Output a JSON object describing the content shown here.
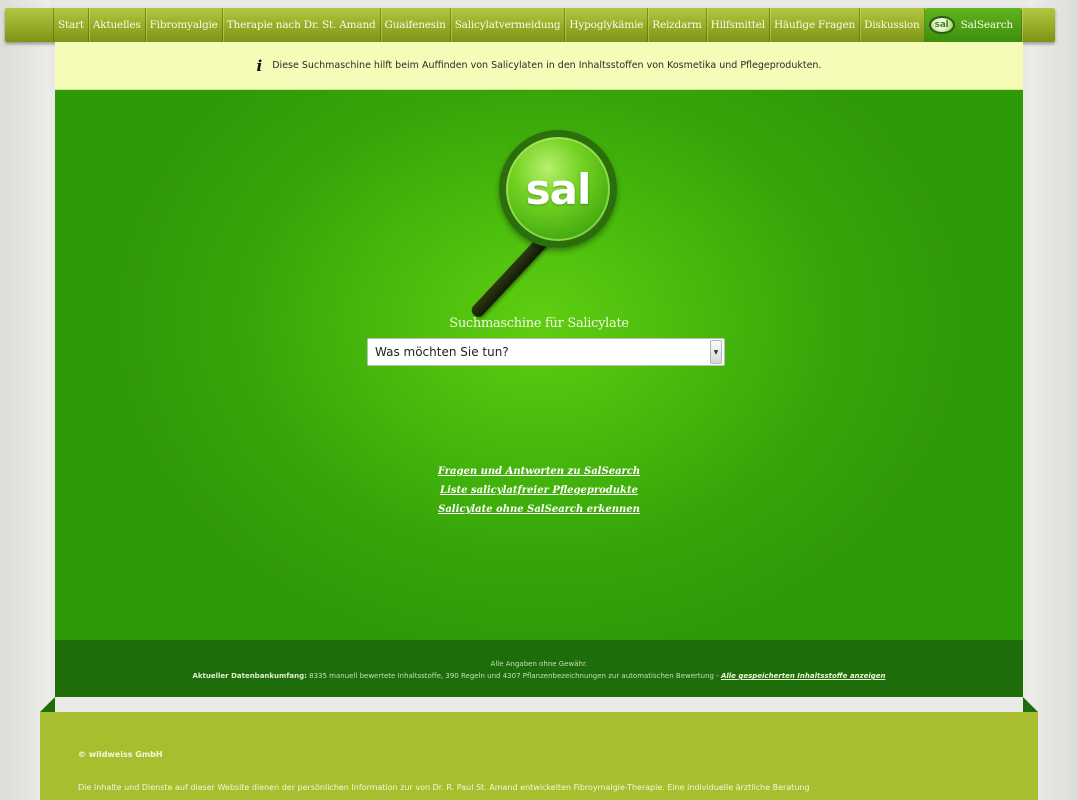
{
  "nav": {
    "items": [
      {
        "label": "Start"
      },
      {
        "label": "Aktuelles"
      },
      {
        "label": "Fibromyalgie"
      },
      {
        "label": "Therapie nach Dr. St. Amand"
      },
      {
        "label": "Guaifenesin"
      },
      {
        "label": "Salicylatvermeidung"
      },
      {
        "label": "Hypoglykämie"
      },
      {
        "label": "Reizdarm"
      },
      {
        "label": "Hilfsmittel"
      },
      {
        "label": "Häufige Fragen"
      },
      {
        "label": "Diskussion"
      }
    ],
    "active": {
      "logo": "sal",
      "label": "SalSearch"
    }
  },
  "info_bar": {
    "icon": "info-icon",
    "text": "Diese Suchmaschine hilft beim Auffinden von Salicylaten in den Inhaltsstoffen von Kosmetika und Pflegeprodukten."
  },
  "logo": {
    "lens_text": "sal",
    "tagline": "Suchmaschine für Salicylate"
  },
  "search": {
    "select_value": "Was möchten Sie tun?"
  },
  "links": [
    {
      "label": "Fragen und Antworten zu SalSearch"
    },
    {
      "label": "Liste salicylatfreier Pflegeprodukte"
    },
    {
      "label": "Salicylate ohne SalSearch erkennen"
    }
  ],
  "db_info": {
    "disclaimer": "Alle Angaben ohne Gewähr.",
    "label": "Aktueller Datenbankumfang:",
    "text": "8335 manuell bewertete Inhaltsstoffe, 390 Regeln und 4307 Pflanzenbezeichnungen zur automatischen Bewertung - ",
    "link": "Alle gespeicherten Inhaltsstoffe anzeigen"
  },
  "footer": {
    "copyright": "© wildweiss GmbH",
    "text": "Die Inhalte und Dienste auf dieser Website dienen der persönlichen Information zur von Dr. R. Paul St. Amand entwickelten Fibroymalgie-Therapie. Eine individuelle ärztliche Beratung"
  },
  "colors": {
    "nav": "#96ab27",
    "info_bar": "#f5fcb8",
    "green": "#37a509",
    "db_strip": "#1e6d0b",
    "footer": "#a8be2f"
  }
}
